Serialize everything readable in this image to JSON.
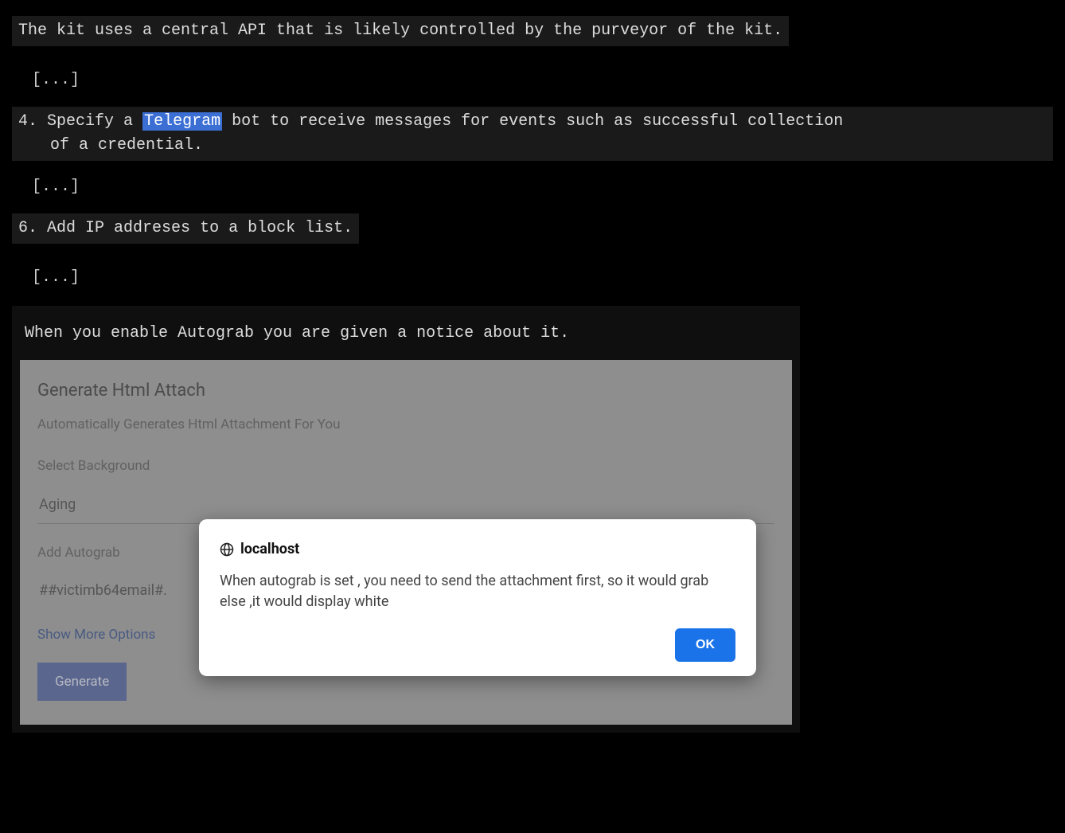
{
  "intro": {
    "line1": "The kit uses a central API that is likely controlled by the purveyor of the kit."
  },
  "ellipsis": "[...]",
  "item4": {
    "num": "4.",
    "pre": "Specify a ",
    "highlight": "Telegram",
    "post": " bot to receive messages for events such as successful collection",
    "cont": "of a credential."
  },
  "item6": {
    "num": "6.",
    "text": "Add IP addreses to a block list."
  },
  "panel": {
    "caption": "When you enable Autograb you are given a notice about it.",
    "form": {
      "title": "Generate Html Attach",
      "subtitle": "Automatically Generates Html Attachment For You",
      "select_label": "Select Background",
      "select_value": "Aging",
      "autograb_label": "Add Autograb",
      "autograb_value": "##victimb64email#.",
      "show_more": "Show More Options",
      "generate_btn": "Generate"
    },
    "alert": {
      "host": "localhost",
      "message": "When autograb is set , you need to send the attachment first, so it would grab else ,it would display white",
      "ok": "OK"
    }
  }
}
